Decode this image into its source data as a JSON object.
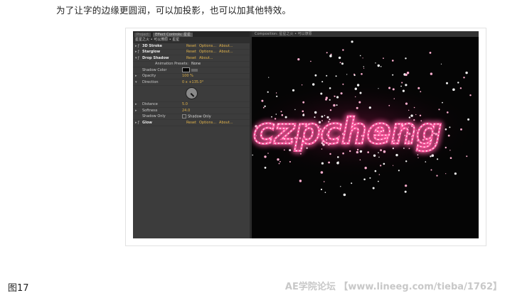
{
  "caption": "为了让字的边缘更圆润，可以加投影，也可以加其他特效。",
  "figure_label": "图17",
  "watermark": "AE学院论坛 【www.lineeg.com/tieba/1762】",
  "effects_panel": {
    "tabs": [
      "Project",
      "Effect Controls: 星星"
    ],
    "layer_path": "星星之火 • 可以燎原 • 星星",
    "rows": [
      {
        "name": "3D Stroke",
        "reset": "Reset",
        "options": "Options...",
        "about": "About..."
      },
      {
        "name": "Starglow",
        "reset": "Reset",
        "options": "Options...",
        "about": "About..."
      },
      {
        "name": "Drop Shadow",
        "reset": "Reset",
        "about": "About..."
      }
    ],
    "animation_presets_label": "Animation Presets:",
    "animation_presets_value": "None",
    "props": {
      "shadow_color": "Shadow Color",
      "opacity_label": "Opacity",
      "opacity_value": "100 %",
      "direction_label": "Direction",
      "direction_value": "0 x +135.0°",
      "distance_label": "Distance",
      "distance_value": "5.0",
      "softness_label": "Softness",
      "softness_value": "24.0",
      "shadow_only_label": "Shadow Only",
      "shadow_only_value": "Shadow Only"
    },
    "glow": {
      "name": "Glow",
      "reset": "Reset",
      "options": "Options...",
      "about": "About..."
    }
  },
  "composition_panel": {
    "tab": "Composition: 星星之火 • 可以燎原",
    "text_art": "czpcheng",
    "glow_color": "#ff5aa0"
  }
}
